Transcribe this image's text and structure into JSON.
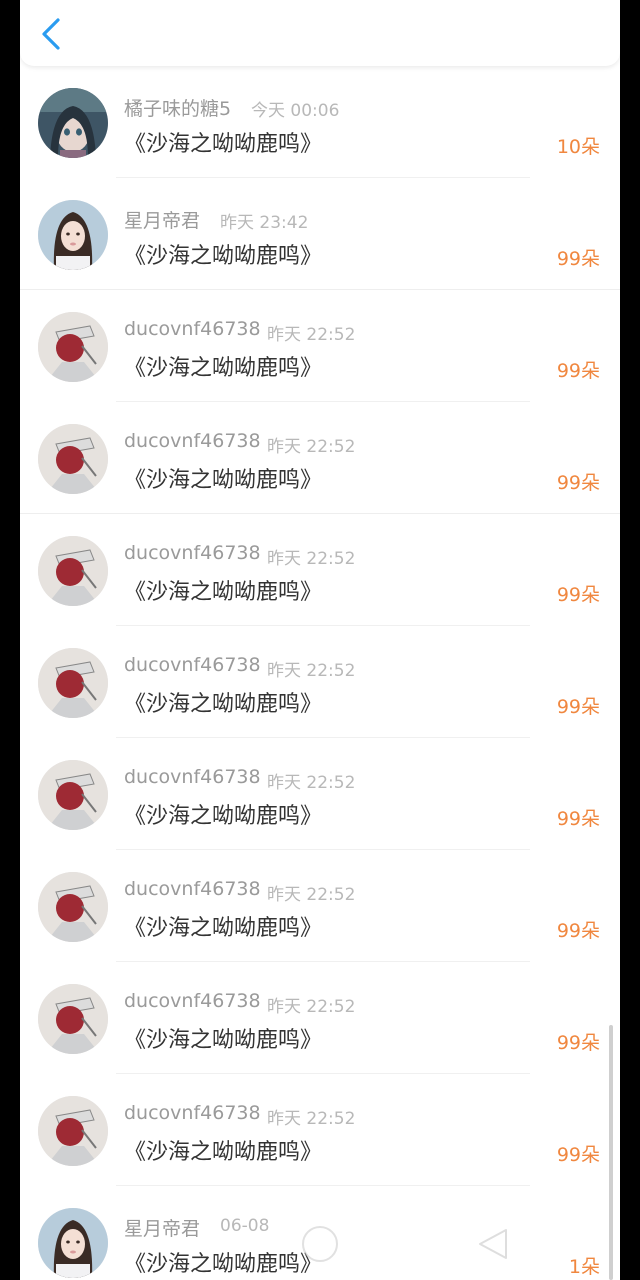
{
  "header": {
    "back_icon": "chevron-left-icon",
    "accent": "#2a9cf0"
  },
  "colors": {
    "count": "#f0873f",
    "name": "#9a9a9a",
    "time": "#b8b8b8",
    "title": "#333333"
  },
  "items": [
    {
      "name": "橘子味的糖5",
      "time": "今天 00:06",
      "title": "《沙海之呦呦鹿鸣》",
      "count": "10朵",
      "avatar": "anime-girl-avatar"
    },
    {
      "name": "星月帝君",
      "time": "昨天 23:42",
      "title": "《沙海之呦呦鹿鸣》",
      "count": "99朵",
      "avatar": "woman-portrait-avatar"
    },
    {
      "name": "ducovnf46738",
      "time": "昨天 22:52",
      "title": "《沙海之呦呦鹿鸣》",
      "count": "99朵",
      "avatar": "red-fan-avatar"
    },
    {
      "name": "ducovnf46738",
      "time": "昨天 22:52",
      "title": "《沙海之呦呦鹿鸣》",
      "count": "99朵",
      "avatar": "red-fan-avatar"
    },
    {
      "name": "ducovnf46738",
      "time": "昨天 22:52",
      "title": "《沙海之呦呦鹿鸣》",
      "count": "99朵",
      "avatar": "red-fan-avatar"
    },
    {
      "name": "ducovnf46738",
      "time": "昨天 22:52",
      "title": "《沙海之呦呦鹿鸣》",
      "count": "99朵",
      "avatar": "red-fan-avatar"
    },
    {
      "name": "ducovnf46738",
      "time": "昨天 22:52",
      "title": "《沙海之呦呦鹿鸣》",
      "count": "99朵",
      "avatar": "red-fan-avatar"
    },
    {
      "name": "ducovnf46738",
      "time": "昨天 22:52",
      "title": "《沙海之呦呦鹿鸣》",
      "count": "99朵",
      "avatar": "red-fan-avatar"
    },
    {
      "name": "ducovnf46738",
      "time": "昨天 22:52",
      "title": "《沙海之呦呦鹿鸣》",
      "count": "99朵",
      "avatar": "red-fan-avatar"
    },
    {
      "name": "ducovnf46738",
      "time": "昨天 22:52",
      "title": "《沙海之呦呦鹿鸣》",
      "count": "99朵",
      "avatar": "red-fan-avatar"
    },
    {
      "name": "星月帝君",
      "time": "06-08",
      "title": "《沙海之呦呦鹿鸣》",
      "count": "1朵",
      "avatar": "woman-portrait-avatar"
    }
  ]
}
